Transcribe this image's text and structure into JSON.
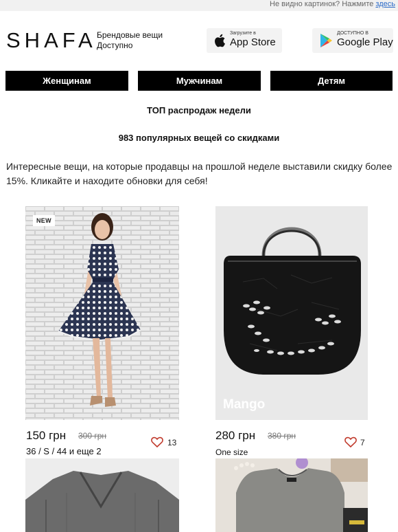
{
  "topbar": {
    "text": "Не видно картинок? Нажмите",
    "link": "здесь"
  },
  "header": {
    "logo": "SHAFA",
    "tagline_line1": "Брендовые вещи",
    "tagline_line2": "Доступно",
    "appstore_small": "Загрузите в",
    "appstore_big": "App Store",
    "googleplay_small": "ДОСТУПНО В",
    "googleplay_big": "Google Play"
  },
  "nav": {
    "women": "Женщинам",
    "men": "Мужчинам",
    "kids": "Детям"
  },
  "headings": {
    "top_sales": "ТОП распродаж недели",
    "popular": "983 популярных вещей со скидками"
  },
  "intro": "Интересные вещи, на которые продавцы на прошлой неделе выставили скидку более 15%. Кликайте и находите обновки для себя!",
  "products": [
    {
      "badge": "NEW",
      "brand": "",
      "price": "150 грн",
      "old_price": "300 грн",
      "likes": "13",
      "sizes": "36 / S / 44  и еще 2"
    },
    {
      "badge": "",
      "brand": "Mango",
      "price": "280 грн",
      "old_price": "380 грн",
      "likes": "7",
      "sizes": "One size"
    }
  ],
  "icons": {
    "heart": "heart-icon",
    "apple": "apple-icon",
    "play": "google-play-icon"
  },
  "colors": {
    "nav_bg": "#000000",
    "link": "#2a6ac8",
    "heart": "#c0392b"
  }
}
